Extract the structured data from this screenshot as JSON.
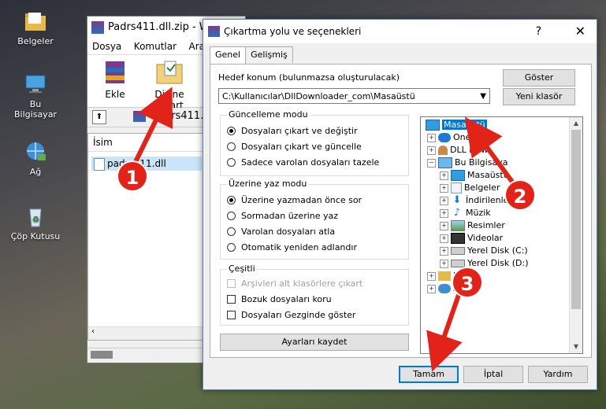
{
  "desktop": {
    "icons": [
      {
        "label": "Belgeler",
        "icon": "folder-icon"
      },
      {
        "label": "Bu Bilgisayar",
        "icon": "computer-icon"
      },
      {
        "label": "Ağ",
        "icon": "network-icon"
      },
      {
        "label": "Çöp Kutusu",
        "icon": "recycle-bin-icon"
      }
    ]
  },
  "rar_window": {
    "title": "Padrs411.dll.zip - W",
    "menu": [
      "Dosya",
      "Komutlar",
      "Araçla"
    ],
    "toolbar": {
      "add_label": "Ekle",
      "extract_label": "Dizine Çıkart"
    },
    "address": "adrs411.co",
    "column_name": "İsim",
    "file_row": "padrs411.dll"
  },
  "dialog": {
    "title": "Çıkartma yolu ve seçenekleri",
    "help": "?",
    "close": "✕",
    "tabs": [
      "Genel",
      "Gelişmiş"
    ],
    "dest_label": "Hedef konum (bulunmazsa oluşturulacak)",
    "dest_value": "C:\\Kullanıcılar\\DllDownloader_com\\Masaüstü",
    "show_button": "Göster",
    "new_folder_button": "Yeni klasör",
    "update_group": {
      "title": "Güncelleme modu",
      "options": [
        "Dosyaları çıkart ve değiştir",
        "Dosyaları çıkart ve güncelle",
        "Sadece varolan dosyaları tazele"
      ],
      "selected": 0
    },
    "overwrite_group": {
      "title": "Üzerine yaz modu",
      "options": [
        "Üzerine yazmadan önce sor",
        "Sormadan üzerine yaz",
        "Varolan dosyaları atla",
        "Otomatik yeniden adlandır"
      ],
      "selected": 0
    },
    "misc_group": {
      "title": "Çeşitli",
      "options": [
        "Arşivleri alt klasörlere çıkart",
        "Bozuk dosyaları koru",
        "Dosyaları Gezginde göster"
      ]
    },
    "save_settings_button": "Ayarları kaydet",
    "tree": [
      {
        "label": "Masaüstü",
        "icon": "desktop-icon"
      },
      {
        "label": "OneDri",
        "icon": "cloud-icon"
      },
      {
        "label": "DLL Dow",
        "icon": "user-icon"
      },
      {
        "label": "Bu Bilgisaya",
        "icon": "computer-icon"
      },
      {
        "label": "Masaüstü",
        "icon": "desktop-icon"
      },
      {
        "label": "Belgeler",
        "icon": "documents-icon"
      },
      {
        "label": "İndirilenler",
        "icon": "download-icon"
      },
      {
        "label": "Müzik",
        "icon": "music-icon"
      },
      {
        "label": "Resimler",
        "icon": "pictures-icon"
      },
      {
        "label": "Videolar",
        "icon": "videos-icon"
      },
      {
        "label": "Yerel Disk (C:)",
        "icon": "drive-icon"
      },
      {
        "label": "Yerel Disk (D:)",
        "icon": "drive-icon"
      },
      {
        "label": "Ki",
        "icon": "library-icon"
      },
      {
        "label": "A",
        "icon": "network-icon"
      }
    ],
    "ok_button": "Tamam",
    "cancel_button": "İptal",
    "help_button": "Yardım"
  },
  "annotations": [
    "1",
    "2",
    "3"
  ],
  "colors": {
    "accent": "#0078d7",
    "badge": "#e2231a",
    "selection": "#cce4f7"
  }
}
